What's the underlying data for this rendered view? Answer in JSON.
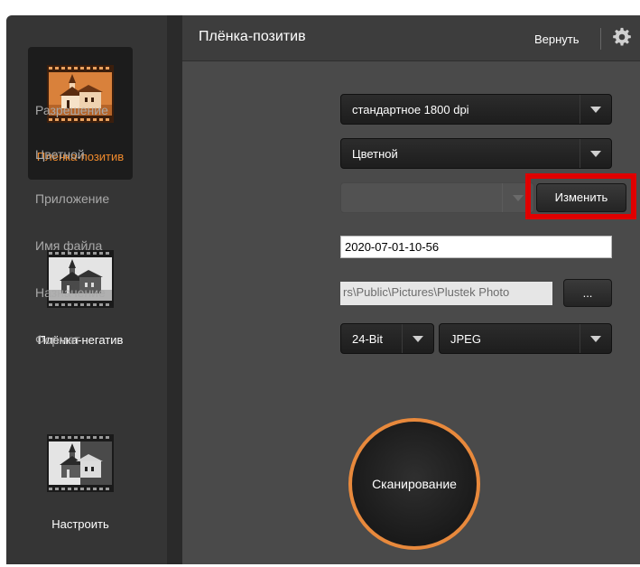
{
  "sidebar": {
    "items": [
      {
        "label": "Плёнка-позитив",
        "selected": true,
        "icon": "film-positive-church-icon"
      },
      {
        "label": "Плёнка-негатив",
        "selected": false,
        "icon": "film-negative-church-icon"
      },
      {
        "label": "Настроить",
        "selected": false,
        "icon": "custom-church-icon"
      }
    ]
  },
  "header": {
    "title": "Плёнка-позитив",
    "revert_label": "Вернуть",
    "settings_icon": "gear-icon"
  },
  "form": {
    "resolution": {
      "label": "Разрешение",
      "value": "стандартное 1800 dpi"
    },
    "color": {
      "label": "Цветной",
      "value": "Цветной"
    },
    "application": {
      "label": "Приложение",
      "value": "",
      "change_label": "Изменить"
    },
    "filename": {
      "label": "Имя файла",
      "value": "2020-07-01-10-56"
    },
    "destination": {
      "label": "Назначение",
      "value": "rs\\Public\\Pictures\\Plustek Photo",
      "browse_label": "..."
    },
    "format": {
      "label": "Формат",
      "bit_depth": "24-Bit",
      "file_type": "JPEG"
    }
  },
  "scan_label": "Сканирование",
  "colors": {
    "accent": "#f08a2c",
    "highlight": "#e00000"
  }
}
